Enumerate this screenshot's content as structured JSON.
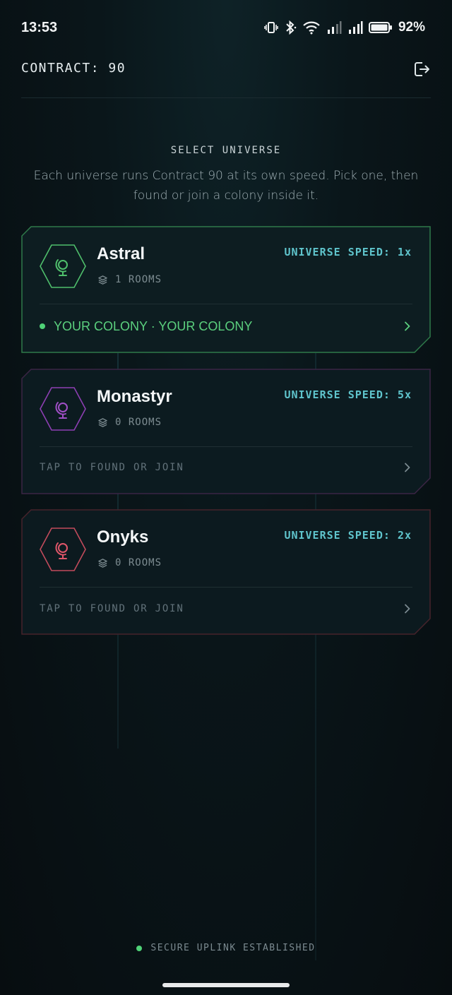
{
  "status": {
    "time": "13:53",
    "battery": "92%"
  },
  "header": {
    "contract_label": "CONTRACT: 90",
    "logout_icon": "logout-icon"
  },
  "intro": {
    "title": "SELECT UNIVERSE",
    "subtitle": "Each universe runs Contract 90 at its own speed. Pick one, then found or join a colony inside it."
  },
  "universes": [
    {
      "name": "Astral",
      "rooms": "1 ROOMS",
      "speed": "UNIVERSE SPEED: 1x",
      "footer": "YOUR COLONY · YOUR COLONY",
      "color": "#4fbf6c",
      "joined": true
    },
    {
      "name": "Monastyr",
      "rooms": "0 ROOMS",
      "speed": "UNIVERSE SPEED: 5x",
      "footer": "TAP TO FOUND OR JOIN",
      "color": "#a04fc6",
      "joined": false
    },
    {
      "name": "Onyks",
      "rooms": "0 ROOMS",
      "speed": "UNIVERSE SPEED: 2x",
      "footer": "TAP TO FOUND OR JOIN",
      "color": "#e0566a",
      "joined": false
    }
  ],
  "footer": {
    "uplink": "SECURE UPLINK ESTABLISHED"
  },
  "colors": {
    "accent_cyan": "#5fc4cc",
    "green": "#4fd277",
    "background": "#0a161a"
  }
}
